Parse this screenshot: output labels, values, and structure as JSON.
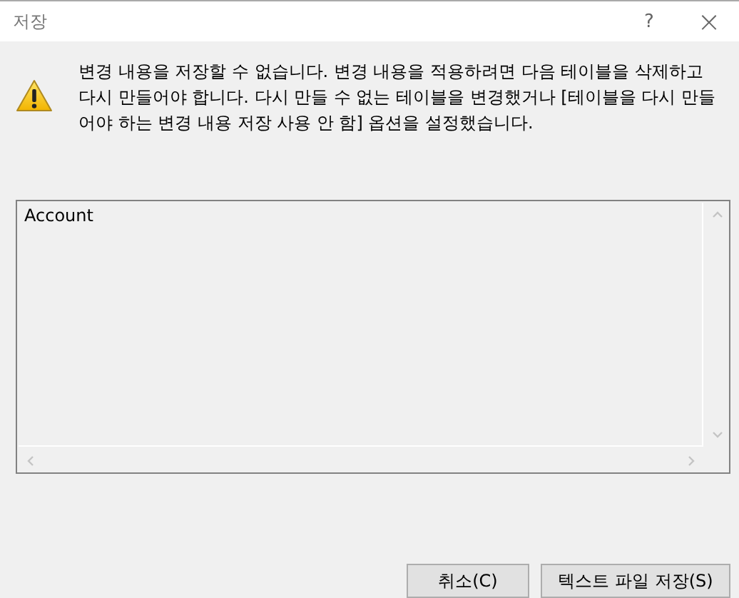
{
  "window": {
    "title": "저장",
    "help": "?",
    "close": "×"
  },
  "message": "변경 내용을 저장할 수 없습니다. 변경 내용을 적용하려면 다음 테이블을 삭제하고 다시 만들어야 합니다. 다시 만들 수 없는 테이블을 변경했거나 [테이블을 다시 만들어야 하는 변경 내용 저장 사용 안 함] 옵션을 설정했습니다.",
  "tables": [
    "Account"
  ],
  "buttons": [
    "취소(C)",
    "텍스트 파일 저장(S)"
  ]
}
